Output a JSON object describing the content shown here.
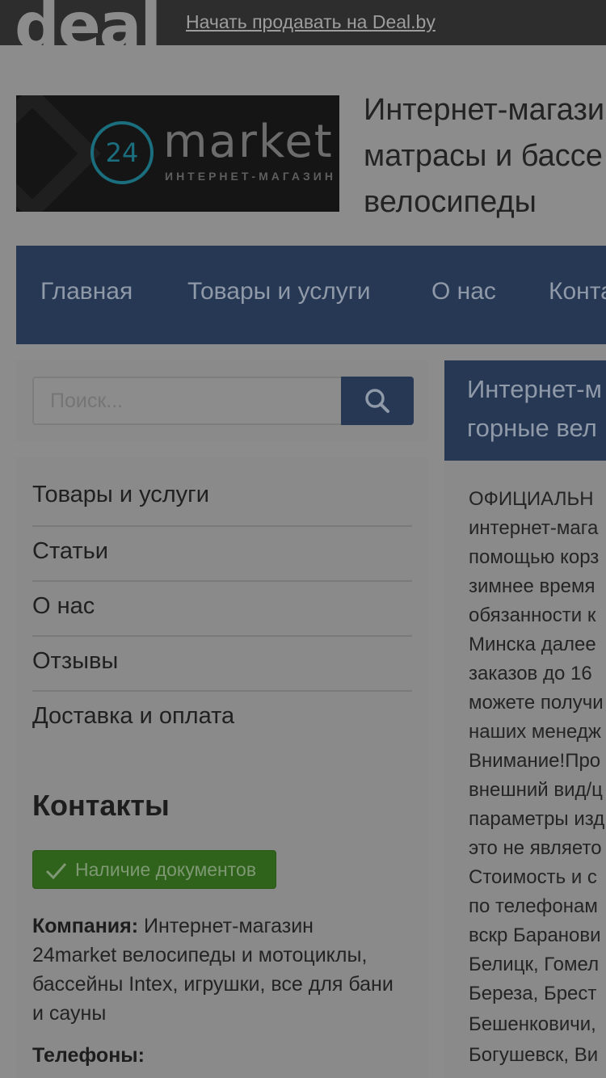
{
  "topbar": {
    "logo_text": "deal",
    "sell_link": "Начать продавать на Deal.by"
  },
  "brand": {
    "circle_text": "24",
    "word": "market",
    "subtitle": "ИНТЕРНЕТ-МАГАЗИН"
  },
  "store_title_lines": [
    "Интернет-магази",
    "матрасы и бассе",
    "велосипеды"
  ],
  "nav": {
    "items": [
      "Главная",
      "Товары и услуги",
      "О нас",
      "Конта"
    ]
  },
  "search": {
    "placeholder": "Поиск...",
    "icon": "search-icon"
  },
  "sidebar": {
    "items": [
      "Товары и услуги",
      "Статьи",
      "О нас",
      "Отзывы",
      "Доставка и оплата"
    ]
  },
  "contacts": {
    "heading": "Контакты",
    "docs_badge": "Наличие документов",
    "company_label": "Компания:",
    "company_lines": [
      "Интернет-магазин",
      "24market велосипеды и мотоциклы,",
      "бассейны Intex, игрушки, все для бани",
      "и сауны"
    ],
    "phones_label": "Телефоны:"
  },
  "content": {
    "heading_lines": [
      "Интернет-м",
      "горные вел"
    ],
    "body_lines": [
      "ОФИЦИАЛЬН",
      "интернет-мага",
      "помощью корз",
      "зимнее время",
      "обязанности к",
      "Минска далее",
      "заказов до 16",
      "можете получи",
      "наших менедж",
      "Внимание!Про",
      "внешний вид/ц",
      "параметры изд",
      "это не являето",
      "Стоимость и с",
      "по телефонам",
      "вскр Баранови",
      "Белицк, Гомел",
      "Береза, Брест",
      "Бешенковичи,",
      "Богушевск, Ви"
    ]
  },
  "colors": {
    "overlay_bg": "#8c8c8c",
    "topbar": "#2d2d2d",
    "nav": "#263854",
    "badge": "#2f621b"
  }
}
